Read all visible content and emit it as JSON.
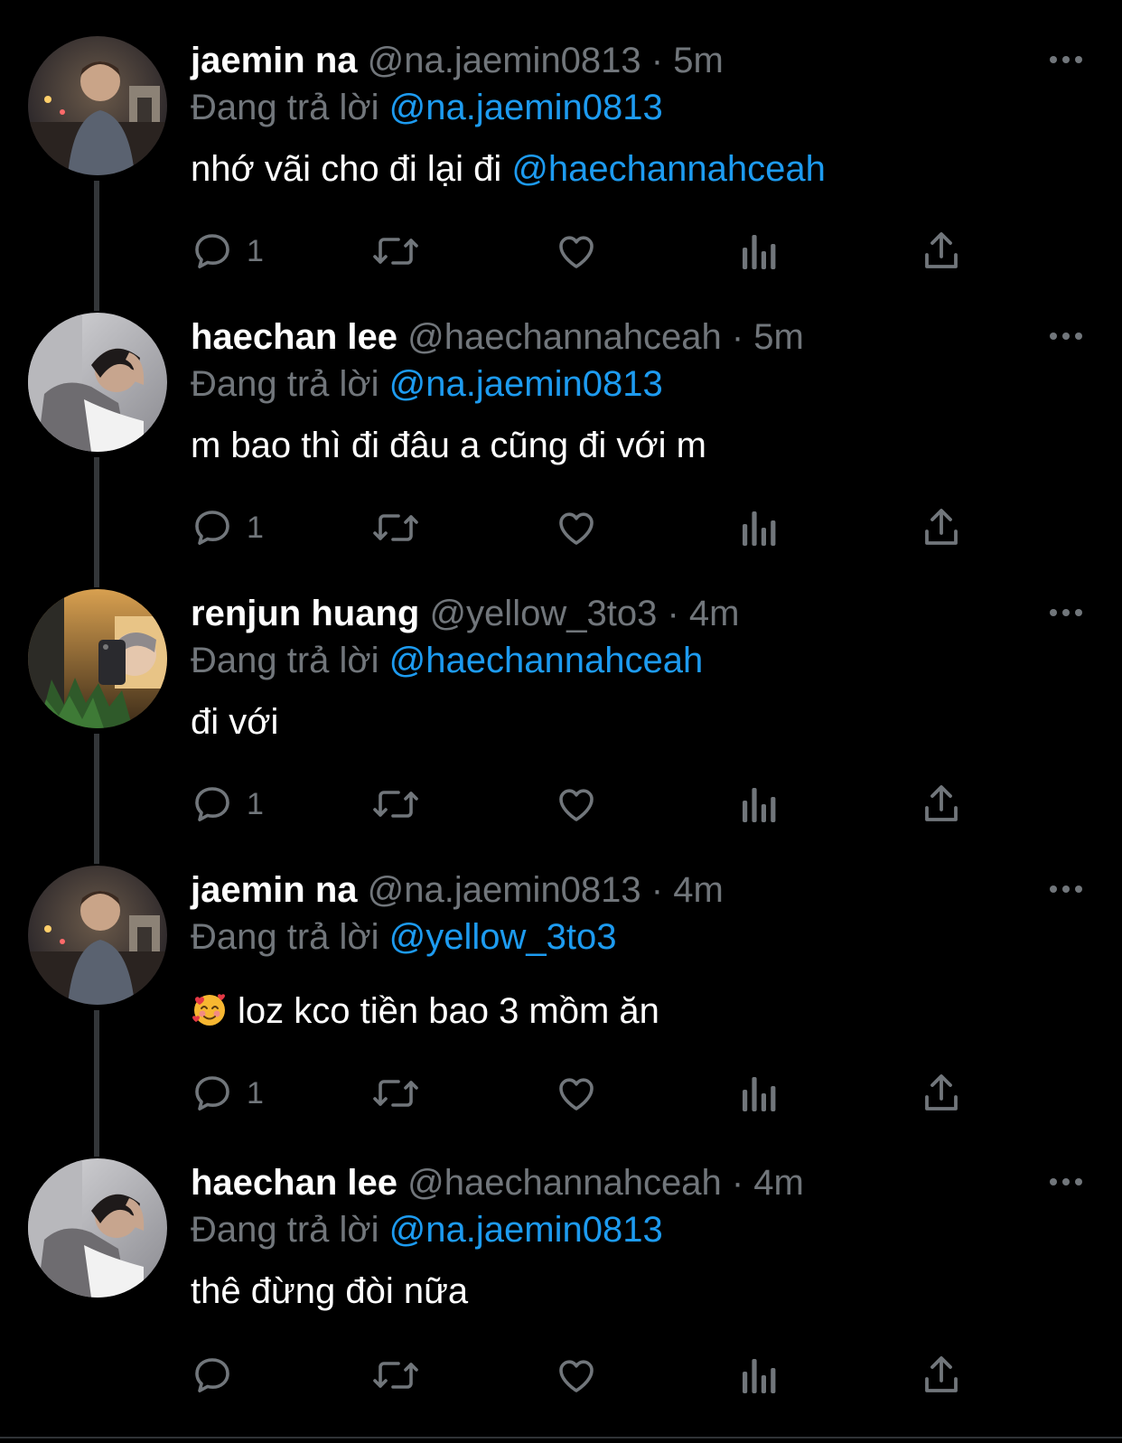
{
  "reply_prefix": "Đang trả lời",
  "colors": {
    "background": "#000000",
    "name": "#ffffff",
    "muted": "#71767b",
    "mention": "#1d9bf0",
    "thread_line": "#333639"
  },
  "tweets": [
    {
      "name": "jaemin na",
      "handle": "@na.jaemin0813",
      "separator": "·",
      "time": "5m",
      "reply_to": "@na.jaemin0813",
      "text": "nhớ vãi cho đi lại đi ",
      "text_mention": "@haechannahceah",
      "reply_count": "1",
      "avatar_icon": "avatar-photo-night-street"
    },
    {
      "name": "haechan lee",
      "handle": "@haechannahceah",
      "separator": "·",
      "time": "5m",
      "reply_to": "@na.jaemin0813",
      "text": "m bao thì đi đâu a cũng đi với m",
      "text_mention": "",
      "reply_count": "1",
      "avatar_icon": "avatar-photo-resting"
    },
    {
      "name": "renjun huang",
      "handle": "@yellow_3to3",
      "separator": "·",
      "time": "4m",
      "reply_to": "@haechannahceah",
      "text": "đi với",
      "text_mention": "",
      "reply_count": "1",
      "avatar_icon": "avatar-photo-mirror-selfie"
    },
    {
      "name": "jaemin na",
      "handle": "@na.jaemin0813",
      "separator": "·",
      "time": "4m",
      "reply_to": "@yellow_3to3",
      "text": "loz kco tiền bao 3 mồm ăn",
      "text_mention": "",
      "emoji_icon": "smiling-face-with-hearts-icon",
      "reply_count": "1",
      "avatar_icon": "avatar-photo-night-street"
    },
    {
      "name": "haechan lee",
      "handle": "@haechannahceah",
      "separator": "·",
      "time": "4m",
      "reply_to": "@na.jaemin0813",
      "text": "thê đừng đòi nữa",
      "text_mention": "",
      "reply_count": "",
      "avatar_icon": "avatar-photo-resting"
    }
  ],
  "action_icons": [
    "reply-icon",
    "retweet-icon",
    "like-icon",
    "views-icon",
    "share-icon"
  ],
  "more_icon": "more-options-icon"
}
